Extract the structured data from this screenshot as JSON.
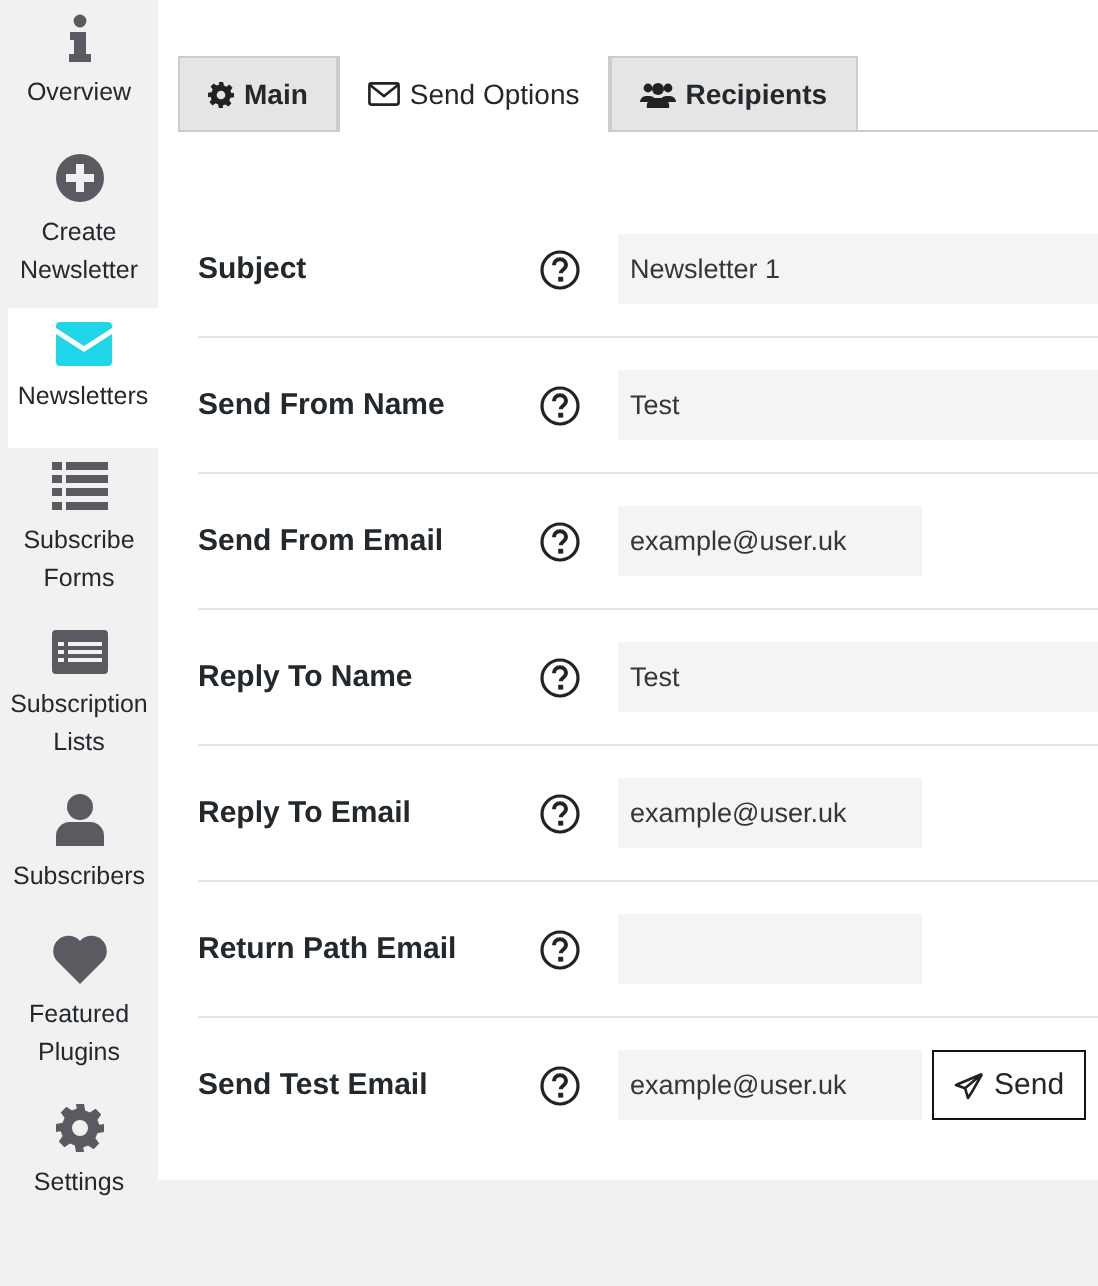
{
  "sidebar": {
    "items": [
      {
        "label": "Overview",
        "kind": "info",
        "selected": false
      },
      {
        "label": "Create Newsletter",
        "kind": "plus",
        "selected": false
      },
      {
        "label": "Newsletters",
        "kind": "envelope",
        "selected": true
      },
      {
        "label": "Subscribe Forms",
        "kind": "list",
        "selected": false
      },
      {
        "label": "Subscription Lists",
        "kind": "card",
        "selected": false
      },
      {
        "label": "Subscribers",
        "kind": "person",
        "selected": false
      },
      {
        "label": "Featured Plugins",
        "kind": "heart",
        "selected": false
      },
      {
        "label": "Settings",
        "kind": "gear",
        "selected": false
      }
    ]
  },
  "tabs": [
    {
      "label": "Main",
      "kind": "gear",
      "selected": false
    },
    {
      "label": "Send Options",
      "kind": "envelope",
      "selected": true
    },
    {
      "label": "Recipients",
      "kind": "users",
      "selected": false
    }
  ],
  "form": {
    "rows": [
      {
        "label": "Subject",
        "kind": "wide",
        "value": "Newsletter 1"
      },
      {
        "label": "Send From Name",
        "kind": "wide",
        "value": "Test"
      },
      {
        "label": "Send From Email",
        "kind": "short",
        "value": "example@user.uk"
      },
      {
        "label": "Reply To Name",
        "kind": "wide",
        "value": "Test"
      },
      {
        "label": "Reply To Email",
        "kind": "short",
        "value": "example@user.uk"
      },
      {
        "label": "Return Path Email",
        "kind": "short"
      },
      {
        "label": "Send Test Email",
        "kind": "short",
        "value": "example@user.uk",
        "button": "Send"
      }
    ]
  }
}
